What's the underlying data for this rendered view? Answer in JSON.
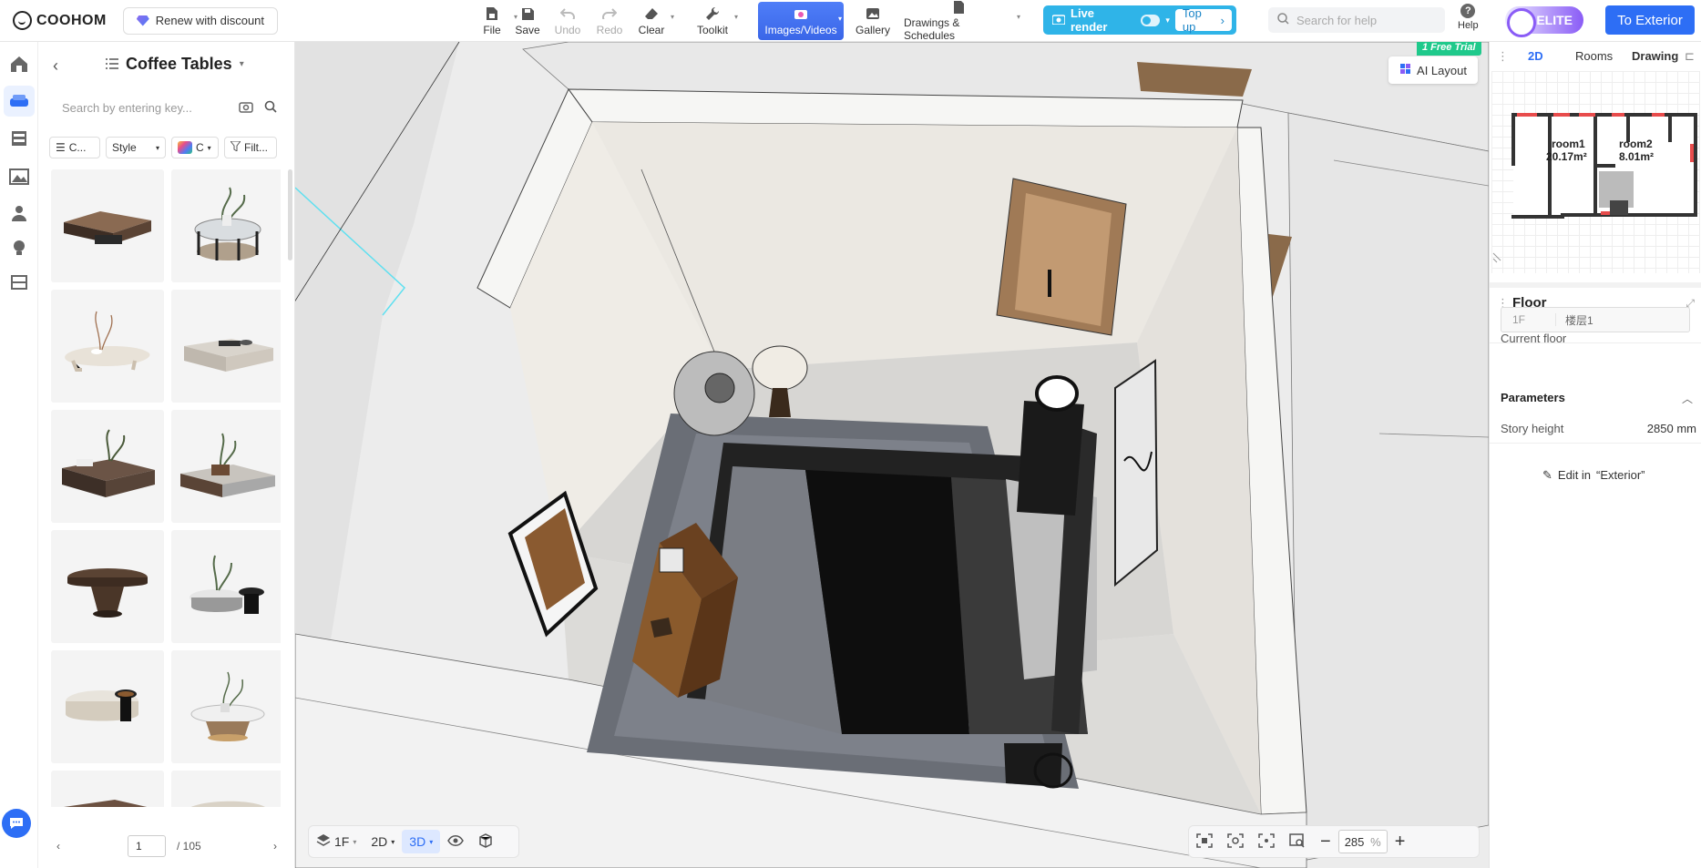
{
  "app": {
    "brand": "COOHOM",
    "renew_label": "Renew with discount"
  },
  "toolbar": {
    "file": "File",
    "save": "Save",
    "undo": "Undo",
    "redo": "Redo",
    "clear": "Clear",
    "toolkit": "Toolkit",
    "images_videos": "Images/Videos",
    "gallery": "Gallery",
    "drawings": "Drawings & Schedules",
    "live_render": "Live render",
    "top_up": "Top up",
    "search_placeholder": "Search for help",
    "help": "Help",
    "elite": "ELITE",
    "to_exterior": "To Exterior"
  },
  "library": {
    "title": "Coffee Tables",
    "search_placeholder": "Search by entering key...",
    "filters": {
      "category": "C...",
      "style": "Style",
      "color": "C",
      "filter": "Filt..."
    },
    "page": "1",
    "total_pages": "/ 105"
  },
  "viewport": {
    "ai_layout": "AI Layout",
    "trial_badge": "1 Free Trial",
    "floor": "1F",
    "view_2d": "2D",
    "view_3d": "3D",
    "zoom_value": "285",
    "zoom_unit": "%"
  },
  "right_panel": {
    "tabs": [
      "2D",
      "Rooms",
      "Drawing"
    ],
    "rooms": [
      {
        "name": "room1",
        "area": "20.17m²"
      },
      {
        "name": "room2",
        "area": "8.01m²"
      }
    ],
    "floor_section": "Floor",
    "current_floor_label": "Current floor",
    "current_floor_code": "1F",
    "current_floor_name": "楼层1",
    "parameters_section": "Parameters",
    "story_height_label": "Story height",
    "story_height_value": "2850 mm",
    "edit_in_label": "Edit in",
    "edit_in_target": "“Exterior”"
  },
  "colors": {
    "accent": "#2d6ef5",
    "live_render": "#2fb4e8",
    "elite": "#8a5cf6",
    "trial": "#1fc98b"
  }
}
